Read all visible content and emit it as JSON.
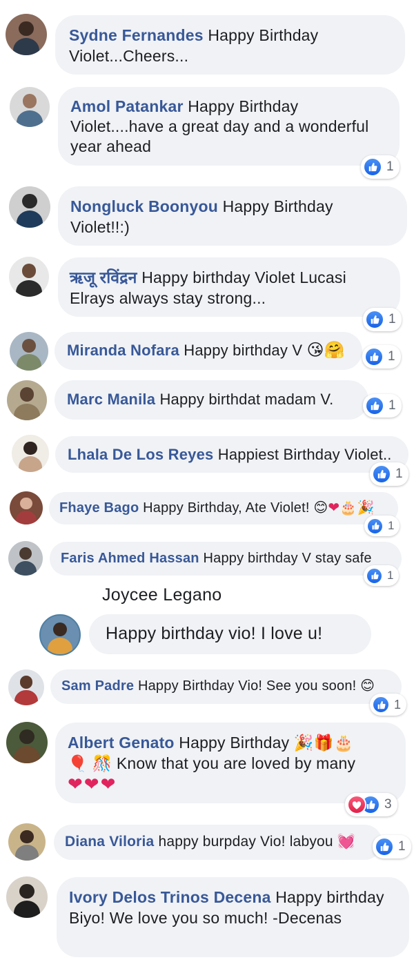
{
  "comments": [
    {
      "author": "Sydne Fernandes",
      "text": "Happy Birthday Violet...Cheers...",
      "reactions": null
    },
    {
      "author": "Amol Patankar",
      "text": "Happy Birthday Violet....have a great day and a wonderful year ahead",
      "reactions": "1"
    },
    {
      "author": "Nongluck Boonyou",
      "text": "Happy Birthday Violet!!:)",
      "reactions": null
    },
    {
      "author": "ऋजू रविंद्रन",
      "text": "Happy birthday Violet Lucasi Elrays always stay strong...",
      "reactions": "1"
    },
    {
      "author": "Miranda Nofara",
      "text": "Happy birthday V",
      "emojis": [
        "😘",
        "🤗"
      ],
      "reactions": "1"
    },
    {
      "author": "Marc Manila",
      "text": "Happy birthdat madam V.",
      "reactions": "1"
    },
    {
      "author": "Lhala De Los Reyes",
      "text": "Happiest Birthday Violet..",
      "reactions": "1"
    },
    {
      "author": "Fhaye Bago",
      "text": "Happy Birthday, Ate Violet!",
      "emojis": [
        "😊",
        "❤",
        "🎂",
        "🎉"
      ],
      "reactions": "1"
    },
    {
      "author": "Faris Ahmed Hassan",
      "text": "Happy birthday V stay safe",
      "reactions": "1"
    },
    {
      "author": "Joycee Legano",
      "text": "Happy birthday vio! I love u!",
      "reactions": null
    },
    {
      "author": "Sam Padre",
      "text": "Happy Birthday Vio! See you soon!",
      "emojis": [
        "😊"
      ],
      "reactions": "1"
    },
    {
      "author": "Albert Genato",
      "text": "Happy Birthday",
      "emojis_line1": [
        "🎉",
        "🎁",
        "🎂"
      ],
      "emojis_line2": [
        "🎈",
        "🎊"
      ],
      "text2": "Know that you are loved by many",
      "emojis_line3": [
        "❤",
        "❤",
        "❤"
      ],
      "reactions": "3"
    },
    {
      "author": "Diana Viloria",
      "text": "happy burpday Vio! labyou",
      "emojis": [
        "💓"
      ],
      "reactions": "1"
    },
    {
      "author": "Ivory Delos Trinos Decena",
      "text": "Happy birthday Biyo! We love you so much! -Decenas",
      "reactions": null
    }
  ],
  "icons": {
    "like": "like-icon",
    "love": "love-icon"
  },
  "colors": {
    "author": "#385898",
    "bubble": "#f0f2f5",
    "like": "#1877f2",
    "love": "#e12049"
  }
}
